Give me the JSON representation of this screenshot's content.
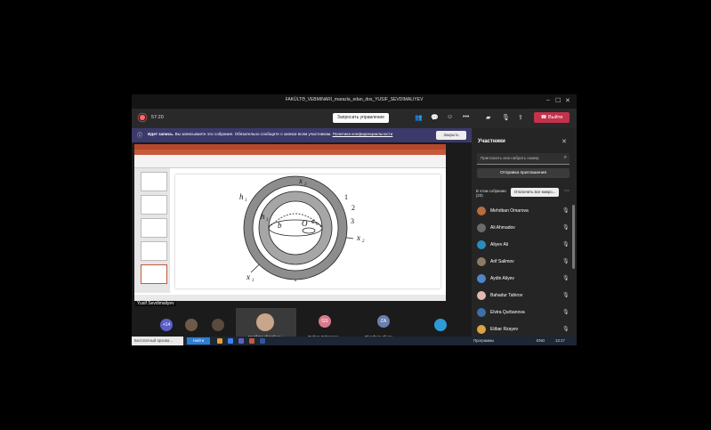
{
  "window": {
    "title": "FAKÜLTƏ_VEBMINARI_marazla_edan_dos_YUSIF_SEVDIMALIYEV",
    "minimize": "–",
    "maximize": "☐",
    "close": "✕"
  },
  "toolbar": {
    "timer": "57:20",
    "request_control": "Запросить управление",
    "leave": "Выйти"
  },
  "banner": {
    "bold": "Идет запись.",
    "text": "Вы записываете это собрание. Обязательно сообщите о записи всем участникам.",
    "link": "Политика конфиденциальности",
    "close_button": "Закрыть"
  },
  "presenter": {
    "name": "Yusif Sevdimaliyev"
  },
  "tiles": [
    {
      "label": "+14"
    },
    {
      "name": "Yusif Sevdimaliyev"
    },
    {
      "initials": "GS",
      "name": "Gulnar Salmanov"
    },
    {
      "initials": "ZA",
      "name": "Ziyadxan Aliyev"
    }
  ],
  "panel": {
    "title": "Участники",
    "invite_placeholder": "Пригласить или набрать номер",
    "send_invite": "Отправка приглашения",
    "in_meeting": "В этом собрании",
    "count": "(20)",
    "mute_all": "Отключить все микро...",
    "participants": [
      {
        "name": "Mehriban Omarova",
        "color": "#b56e3d"
      },
      {
        "name": "Ali Ahmadov",
        "color": "#6a6a6a"
      },
      {
        "name": "Aliyev Ali",
        "color": "#2c8bbd"
      },
      {
        "name": "Arif Salimov",
        "color": "#8c7a63"
      },
      {
        "name": "Aydin Aliyev",
        "color": "#4f86c6"
      },
      {
        "name": "Bahadur Tahirov",
        "color": "#e2b8b0"
      },
      {
        "name": "Elvira Qurbanova",
        "color": "#3d6fa8"
      },
      {
        "name": "Etibar Rzayev",
        "color": "#d9a441"
      }
    ]
  },
  "taskbar": {
    "search": "Бесплатный архива...",
    "active_app": "Найти",
    "tray": "Программы",
    "lang": "ENG",
    "time": "13:17"
  },
  "accent": "#c4314b"
}
